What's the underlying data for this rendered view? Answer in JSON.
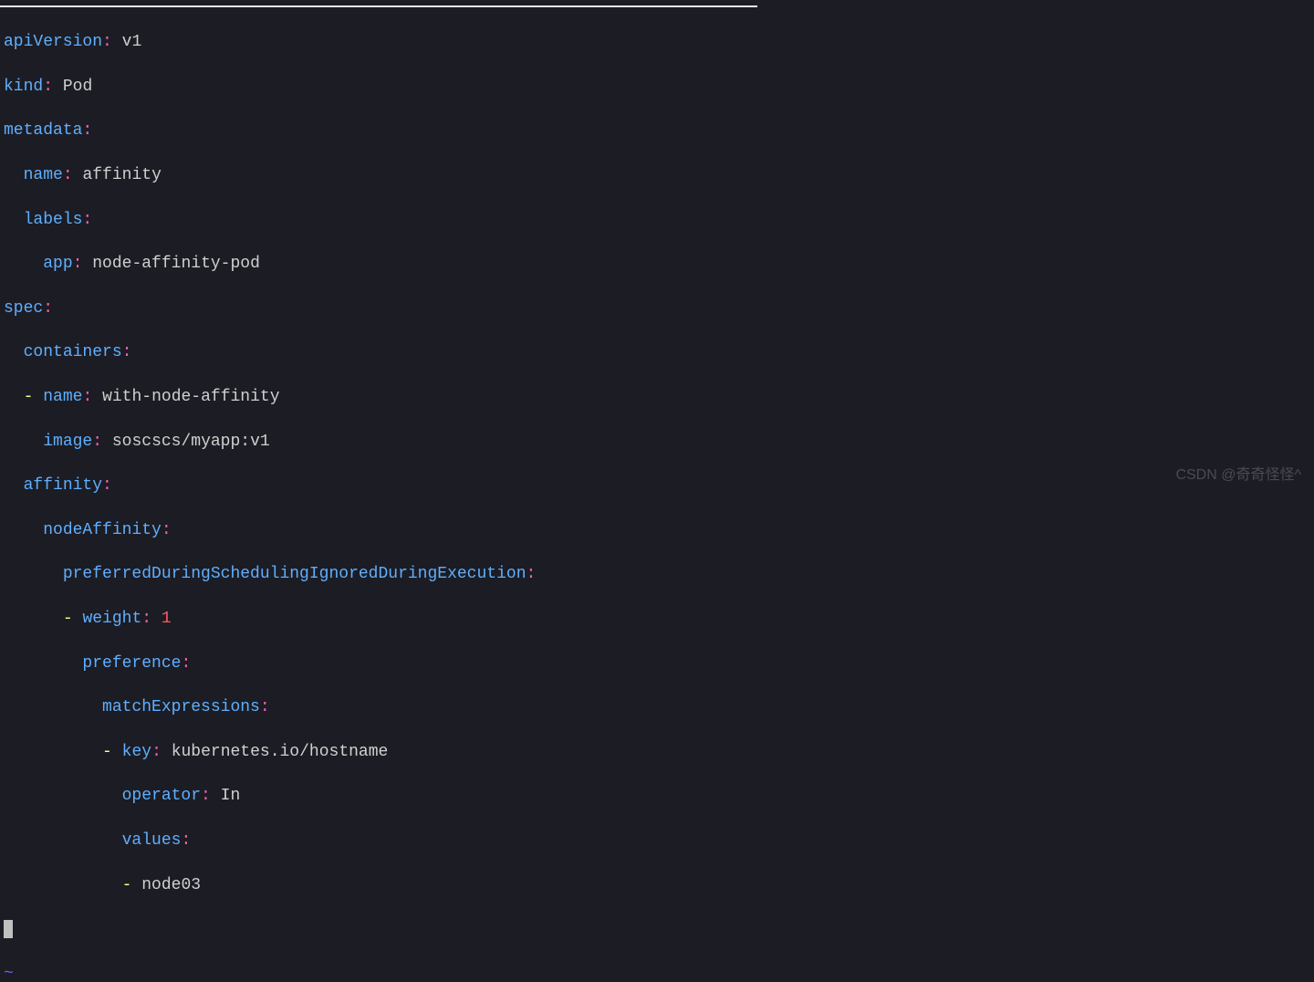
{
  "yaml": {
    "apiVersion": {
      "key": "apiVersion",
      "val": "v1"
    },
    "kind": {
      "key": "kind",
      "val": "Pod"
    },
    "metadata": {
      "key": "metadata"
    },
    "metaName": {
      "key": "name",
      "val": "affinity"
    },
    "labels": {
      "key": "labels"
    },
    "app": {
      "key": "app",
      "val": "node-affinity-pod"
    },
    "spec": {
      "key": "spec"
    },
    "containers": {
      "key": "containers"
    },
    "containerName": {
      "key": "name",
      "val": "with-node-affinity"
    },
    "image": {
      "key": "image",
      "val": "soscscs/myapp:v1"
    },
    "affinity": {
      "key": "affinity"
    },
    "nodeAffinity": {
      "key": "nodeAffinity"
    },
    "preferred": {
      "key": "preferredDuringSchedulingIgnoredDuringExecution"
    },
    "weight": {
      "key": "weight",
      "val": "1"
    },
    "preference": {
      "key": "preference"
    },
    "matchExpressions": {
      "key": "matchExpressions"
    },
    "matchKey": {
      "key": "key",
      "val": "kubernetes.io/hostname"
    },
    "operator": {
      "key": "operator",
      "val": "In"
    },
    "values": {
      "key": "values"
    },
    "node03": {
      "val": "node03"
    }
  },
  "watermark": "CSDN @奇奇怪怪^",
  "tilde": "~",
  "colon": ":",
  "dash": "-",
  "space": " "
}
